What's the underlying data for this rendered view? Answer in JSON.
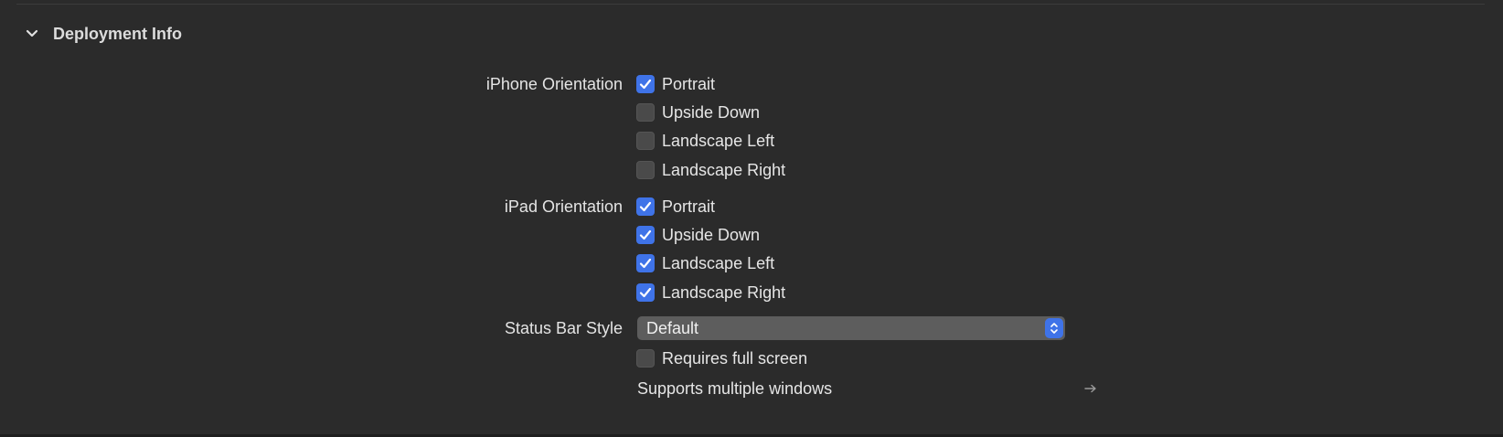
{
  "section": {
    "title": "Deployment Info"
  },
  "iphone_orientation": {
    "label": "iPhone Orientation",
    "options": [
      {
        "label": "Portrait",
        "checked": true
      },
      {
        "label": "Upside Down",
        "checked": false
      },
      {
        "label": "Landscape Left",
        "checked": false
      },
      {
        "label": "Landscape Right",
        "checked": false
      }
    ]
  },
  "ipad_orientation": {
    "label": "iPad Orientation",
    "options": [
      {
        "label": "Portrait",
        "checked": true
      },
      {
        "label": "Upside Down",
        "checked": true
      },
      {
        "label": "Landscape Left",
        "checked": true
      },
      {
        "label": "Landscape Right",
        "checked": true
      }
    ]
  },
  "status_bar": {
    "label": "Status Bar Style",
    "selected": "Default"
  },
  "requires_full_screen": {
    "label": "Requires full screen",
    "checked": false
  },
  "multiple_windows": {
    "label": "Supports multiple windows"
  },
  "colors": {
    "background": "#2b2b2b",
    "accent": "#3f73e8",
    "checkbox_off": "#4a4a4a",
    "select_bg": "#5d5d5d"
  },
  "icons": {
    "section_toggle": "chevron-down-icon",
    "checkmark": "checkmark-icon",
    "select_stepper": "up-down-chevron-icon",
    "navigate": "arrow-right-icon"
  }
}
